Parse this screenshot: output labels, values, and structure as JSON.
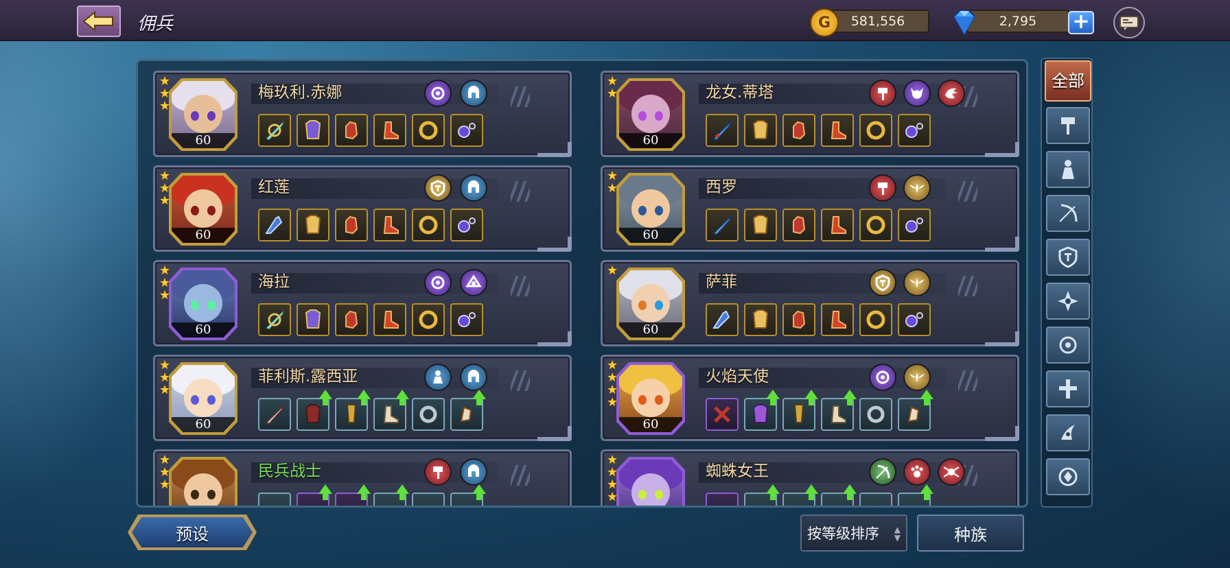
{
  "header": {
    "back_icon": "back-arrow-icon",
    "title": "佣兵",
    "gold": "581,556",
    "gems": "2,795",
    "plus_icon": "plus-icon",
    "mail_icon": "mail-icon"
  },
  "colors": {
    "gold_text": "#f2d7a4",
    "green_text": "#7be05a",
    "accent_red": "#c06a4a",
    "upgrade_arrow": "#5fe03a"
  },
  "heroes": [
    {
      "name": "梅玖利.赤娜",
      "level": "60",
      "stars": 3,
      "frame": "gold",
      "badges": [
        "purple",
        "blue"
      ]
    },
    {
      "name": "龙女.蒂塔",
      "level": "60",
      "stars": 2,
      "frame": "gold",
      "badges": [
        "red",
        "purple",
        "red"
      ]
    },
    {
      "name": "红莲",
      "level": "60",
      "stars": 3,
      "frame": "gold",
      "badges": [
        "gold",
        "blue"
      ]
    },
    {
      "name": "西罗",
      "level": "60",
      "stars": 2,
      "frame": "gold",
      "badges": [
        "red",
        "gold"
      ]
    },
    {
      "name": "海拉",
      "level": "60",
      "stars": 3,
      "frame": "purple",
      "badges": [
        "purple",
        "purple"
      ]
    },
    {
      "name": "萨菲",
      "level": "60",
      "stars": 1,
      "frame": "gold",
      "badges": [
        "gold",
        "gold"
      ]
    },
    {
      "name": "菲利斯.露西亚",
      "level": "60",
      "stars": 3,
      "frame": "gold",
      "badges": [
        "blue",
        "blue"
      ]
    },
    {
      "name": "火焰天使",
      "level": "60",
      "stars": 4,
      "frame": "purple",
      "badges": [
        "purple",
        "gold"
      ]
    },
    {
      "name": "民兵战士",
      "level": "",
      "stars": 3,
      "frame": "gold",
      "badges": [
        "red",
        "blue"
      ]
    },
    {
      "name": "蜘蛛女王",
      "level": "",
      "stars": 4,
      "frame": "purple",
      "badges": [
        "green",
        "red",
        "red"
      ]
    }
  ],
  "filters": {
    "all_label": "全部",
    "icons": [
      "hammer-icon",
      "knight-icon",
      "bow-icon",
      "shield-icon",
      "shuriken-icon",
      "eye-icon",
      "cross-icon",
      "claw-icon",
      "rune-icon"
    ]
  },
  "footer": {
    "preset_label": "预设",
    "sort_label": "按等级排序",
    "race_label": "种族"
  }
}
